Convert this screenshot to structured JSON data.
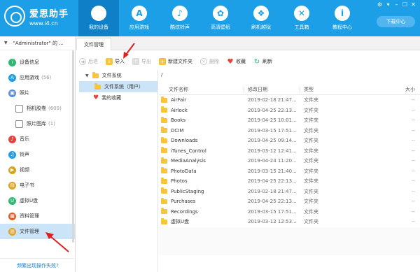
{
  "app": {
    "logo_name": "爱思助手",
    "logo_url": "www.i4.cn",
    "download_center": "下载中心"
  },
  "nav": [
    {
      "label": "我的设备",
      "icon": "apple-icon",
      "glyph": "",
      "active": true
    },
    {
      "label": "应用游戏",
      "icon": "app-store-icon",
      "glyph": "A"
    },
    {
      "label": "酷炫铃声",
      "icon": "bell-icon",
      "glyph": "♪"
    },
    {
      "label": "高清壁纸",
      "icon": "flower-icon",
      "glyph": "✿"
    },
    {
      "label": "刷机越狱",
      "icon": "box-icon",
      "glyph": "❖"
    },
    {
      "label": "工具箱",
      "icon": "tools-icon",
      "glyph": "✕"
    },
    {
      "label": "教程中心",
      "icon": "info-icon",
      "glyph": "i"
    }
  ],
  "window_controls": [
    "⚙",
    "▾",
    "–",
    "☐",
    "✕"
  ],
  "sidebar": {
    "device_name": "\"Administrator\" 的 ...",
    "items": [
      {
        "label": "设备信息",
        "icon": "info-circle-icon",
        "color": "#2eb872",
        "glyph": "i"
      },
      {
        "label": "应用游戏",
        "count": "(56)",
        "icon": "apps-icon",
        "color": "#1d9fe8",
        "glyph": "A"
      },
      {
        "label": "照片",
        "icon": "photo-icon",
        "color": "#5b8fd6",
        "glyph": "▣"
      },
      {
        "label": "相机胶卷",
        "count": "(609)",
        "icon": "camera-roll-icon",
        "color": "#888",
        "glyph": "▭",
        "sub": true
      },
      {
        "label": "照片图库",
        "count": "(1)",
        "icon": "photo-library-icon",
        "color": "#888",
        "glyph": "▭",
        "sub": true
      },
      {
        "label": "音乐",
        "icon": "music-icon",
        "color": "#e9413d",
        "glyph": "♪"
      },
      {
        "label": "铃声",
        "icon": "bell-icon",
        "color": "#1d9fe8",
        "glyph": "♫"
      },
      {
        "label": "视频",
        "icon": "video-icon",
        "color": "#d9a21b",
        "glyph": "▶"
      },
      {
        "label": "电子书",
        "icon": "ebook-icon",
        "color": "#d9a21b",
        "glyph": "▤"
      },
      {
        "label": "虚拟U盘",
        "icon": "usb-icon",
        "color": "#2eb872",
        "glyph": "U"
      },
      {
        "label": "资料管理",
        "icon": "data-icon",
        "color": "#e05a2b",
        "glyph": "▦"
      },
      {
        "label": "文件管理",
        "icon": "file-manager-icon",
        "color": "#e1a02a",
        "glyph": "▥",
        "active": true
      }
    ],
    "help_link": "频繁出现操作失败?"
  },
  "tab": {
    "label": "文件管理"
  },
  "toolbar": {
    "back": "后退",
    "import": "导入",
    "export": "导出",
    "new_folder": "新建文件夹",
    "delete": "删除",
    "favorite": "收藏",
    "refresh": "刷新"
  },
  "tree": {
    "root": "文件系统",
    "child": "文件系统（用户）",
    "favorites": "我的收藏"
  },
  "path": "/",
  "columns": {
    "name": "文件名称",
    "date": "修改日期",
    "type": "类型",
    "size": "大小"
  },
  "files": [
    {
      "name": "AirFair",
      "date": "2019-02-18 21:47...",
      "type": "文件夹",
      "size": "--"
    },
    {
      "name": "Airlock",
      "date": "2019-04-25 22:13...",
      "type": "文件夹",
      "size": "--"
    },
    {
      "name": "Books",
      "date": "2019-04-25 10:01...",
      "type": "文件夹",
      "size": "--"
    },
    {
      "name": "DCIM",
      "date": "2019-03-15 17:51...",
      "type": "文件夹",
      "size": "--"
    },
    {
      "name": "Downloads",
      "date": "2019-04-25 09:14...",
      "type": "文件夹",
      "size": "--"
    },
    {
      "name": "iTunes_Control",
      "date": "2019-03-12 12:41...",
      "type": "文件夹",
      "size": "--"
    },
    {
      "name": "MediaAnalysis",
      "date": "2019-04-24 11:20...",
      "type": "文件夹",
      "size": "--"
    },
    {
      "name": "PhotoData",
      "date": "2019-03-15 21:40...",
      "type": "文件夹",
      "size": "--"
    },
    {
      "name": "Photos",
      "date": "2019-04-25 22:13...",
      "type": "文件夹",
      "size": "--"
    },
    {
      "name": "PublicStaging",
      "date": "2019-02-18 21:47...",
      "type": "文件夹",
      "size": "--"
    },
    {
      "name": "Purchases",
      "date": "2019-04-25 22:13...",
      "type": "文件夹",
      "size": "--"
    },
    {
      "name": "Recordings",
      "date": "2019-03-15 17:51...",
      "type": "文件夹",
      "size": "--"
    },
    {
      "name": "虚拟U盘",
      "date": "2019-03-12 12:53...",
      "type": "文件夹",
      "size": "--"
    }
  ],
  "colors": {
    "accent": "#1d9fe8",
    "active_nav": "#0f7fc8",
    "selection": "#cce4f7",
    "folder": "#f9c33a",
    "arrow": "#e02020"
  }
}
